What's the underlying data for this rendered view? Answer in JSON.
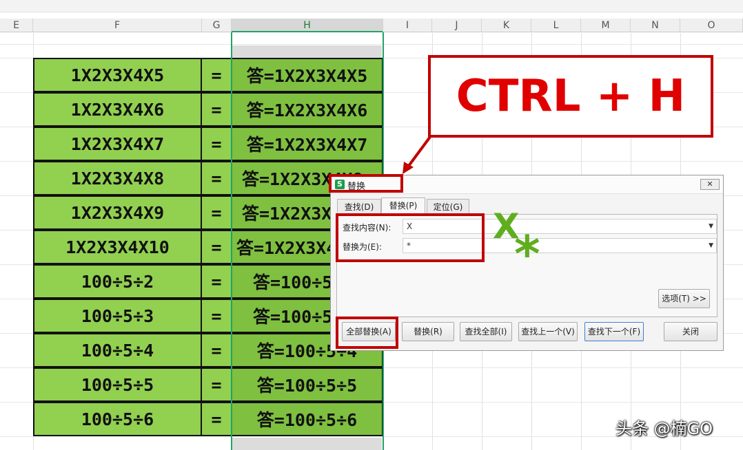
{
  "spreadsheet": {
    "columns": [
      "E",
      "F",
      "G",
      "H",
      "I",
      "J",
      "K",
      "L",
      "M",
      "N",
      "O"
    ],
    "selected_column": "H",
    "rows": [
      {
        "f": "1X2X3X4X5",
        "g": "=",
        "h": "答=1X2X3X4X5"
      },
      {
        "f": "1X2X3X4X6",
        "g": "=",
        "h": "答=1X2X3X4X6"
      },
      {
        "f": "1X2X3X4X7",
        "g": "=",
        "h": "答=1X2X3X4X7"
      },
      {
        "f": "1X2X3X4X8",
        "g": "=",
        "h": "答=1X2X3X4X8"
      },
      {
        "f": "1X2X3X4X9",
        "g": "=",
        "h": "答=1X2X3X4X9"
      },
      {
        "f": "1X2X3X4X10",
        "g": "=",
        "h": "答=1X2X3X4X10"
      },
      {
        "f": "100÷5÷2",
        "g": "=",
        "h": "答=100÷5÷2"
      },
      {
        "f": "100÷5÷3",
        "g": "=",
        "h": "答=100÷5÷3"
      },
      {
        "f": "100÷5÷4",
        "g": "=",
        "h": "答=100÷5÷4"
      },
      {
        "f": "100÷5÷5",
        "g": "=",
        "h": "答=100÷5÷5"
      },
      {
        "f": "100÷5÷6",
        "g": "=",
        "h": "答=100÷5÷6"
      }
    ]
  },
  "callout": {
    "text": "CTRL + H"
  },
  "dialog": {
    "title": "替换",
    "logo": "S",
    "close": "✕",
    "tabs": [
      "查找(D)",
      "替换(P)",
      "定位(G)"
    ],
    "active_tab": "替换(P)",
    "find_label": "查找内容(N):",
    "find_value": "X",
    "replace_label": "替换为(E):",
    "replace_value": "*",
    "options_button": "选项(T) >>",
    "buttons": {
      "replace_all": "全部替换(A)",
      "replace": "替换(R)",
      "find_all": "查找全部(I)",
      "find_prev": "查找上一个(V)",
      "find_next": "查找下一个(F)",
      "close": "关闭"
    }
  },
  "annotations": {
    "x": "X",
    "star": "*"
  },
  "watermark": "头条 @楠GO",
  "colors": {
    "cell_green": "#92d050",
    "selected_green": "#7fc040",
    "callout_red": "#c00000",
    "text_red": "#e00000",
    "annotation_green": "#5fae1e"
  }
}
